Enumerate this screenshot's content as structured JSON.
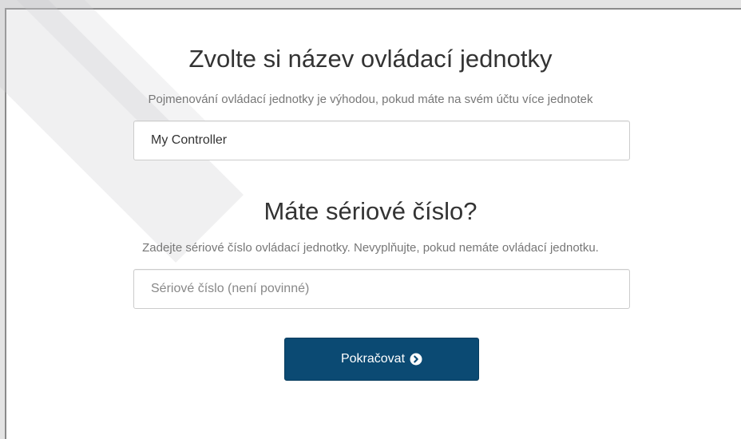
{
  "name_section": {
    "title": "Zvolte si název ovládací jednotky",
    "description": "Pojmenování ovládací jednotky je výhodou, pokud máte na svém účtu více jednotek",
    "input_value": "My Controller"
  },
  "serial_section": {
    "title": "Máte sériové číslo?",
    "description": "Zadejte sériové číslo ovládací jednotky. Nevyplňujte, pokud nemáte ovládací jednotku.",
    "input_placeholder": "Sériové číslo (není povinné)"
  },
  "continue_button": {
    "label": "Pokračovat",
    "icon": "chevron-circle-right-icon"
  },
  "colors": {
    "button_background": "#0b4a73",
    "heading_text": "#333333",
    "description_text": "#777777"
  }
}
